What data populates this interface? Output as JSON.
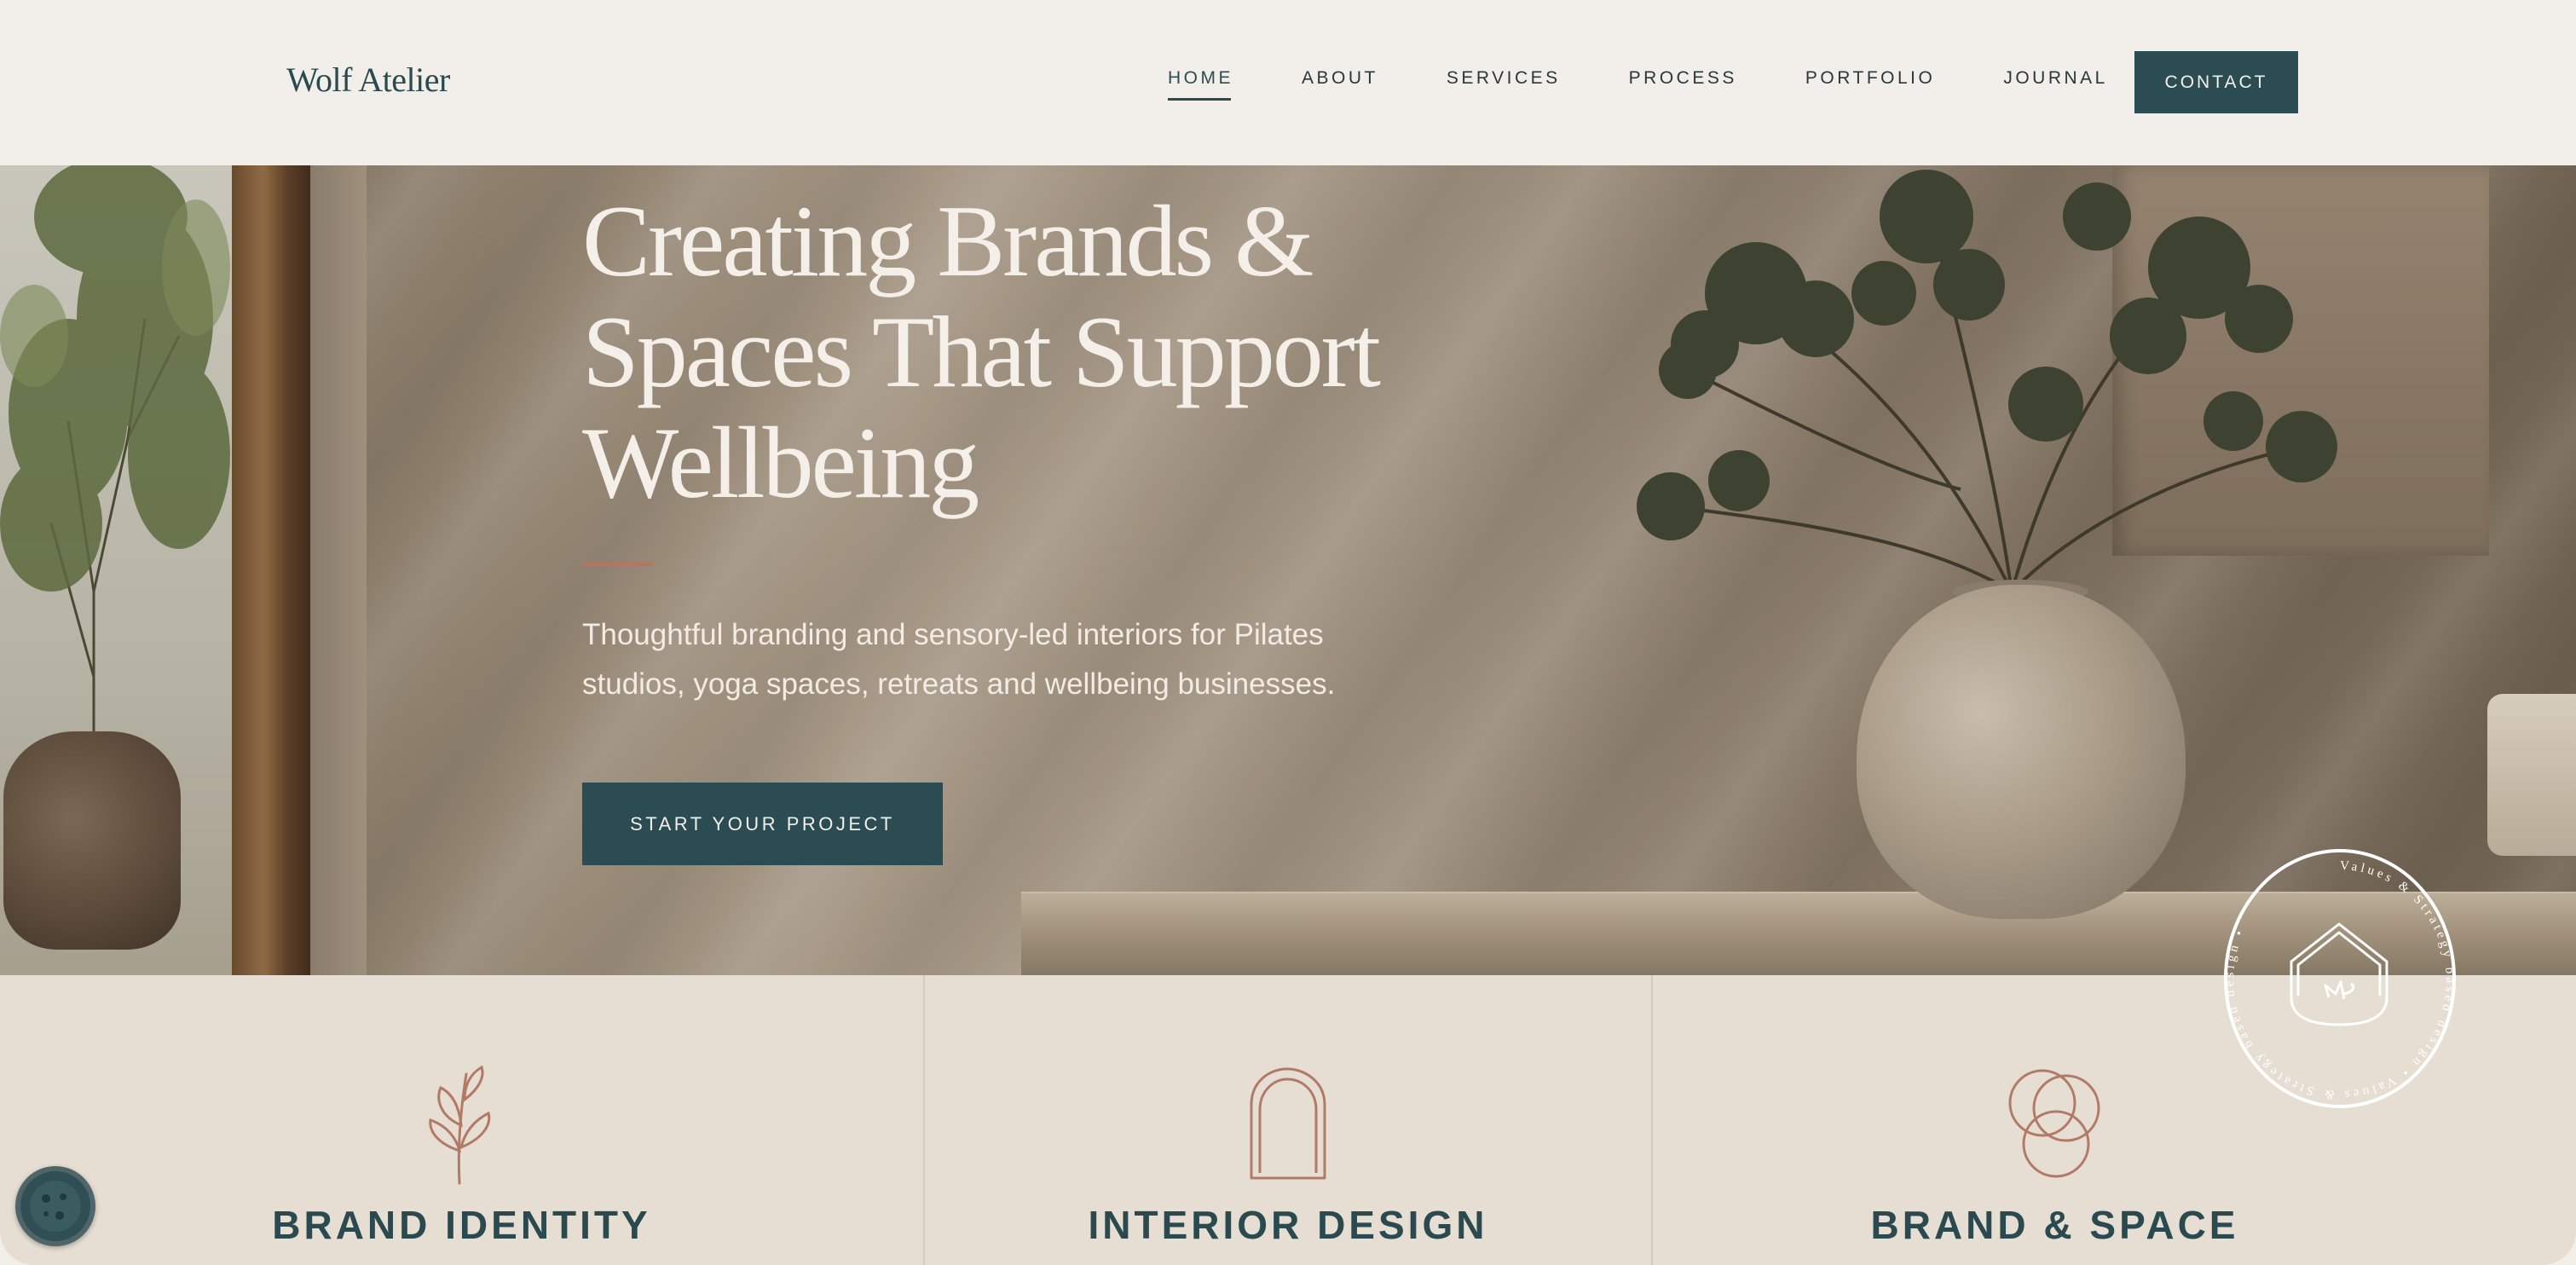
{
  "brand": {
    "logo_text": "Wolf Atelier"
  },
  "nav": {
    "items": [
      {
        "label": "HOME",
        "active": true
      },
      {
        "label": "ABOUT",
        "active": false
      },
      {
        "label": "SERVICES",
        "active": false
      },
      {
        "label": "PROCESS",
        "active": false
      },
      {
        "label": "PORTFOLIO",
        "active": false
      },
      {
        "label": "JOURNAL",
        "active": false
      }
    ],
    "contact_label": "CONTACT"
  },
  "hero": {
    "title": "Creating Brands & Spaces That Support Wellbeing",
    "subtitle": "Thoughtful branding and sensory-led interiors for Pilates studios, yoga spaces, retreats and wellbeing businesses.",
    "cta_label": "START YOUR PROJECT"
  },
  "badge": {
    "ring_text": "Values & Strategy based design • Values & Strategy based design •",
    "icon": "house-monogram-icon"
  },
  "services": [
    {
      "label": "BRAND IDENTITY",
      "icon": "sprig-icon"
    },
    {
      "label": "INTERIOR DESIGN",
      "icon": "arch-icon"
    },
    {
      "label": "BRAND & SPACE",
      "icon": "interlocking-circles-icon"
    }
  ],
  "colors": {
    "primary": "#2b4c52",
    "accent": "#b8755c",
    "background": "#f2eee9",
    "section_bg": "#e6ded2",
    "icon_stroke": "#b27a66"
  }
}
